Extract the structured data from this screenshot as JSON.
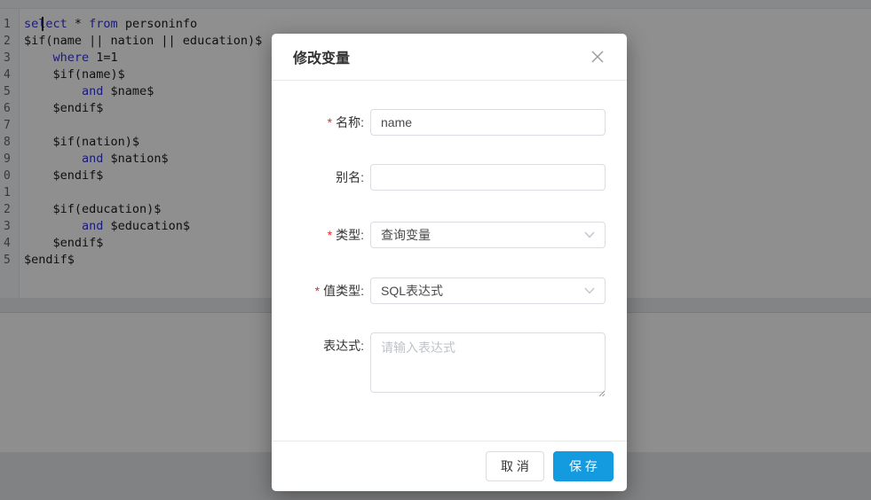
{
  "editor": {
    "gutter_digits": [
      "1",
      "2",
      "3",
      "4",
      "5",
      "6",
      "7",
      "8",
      "9",
      "0",
      "1",
      "2",
      "3",
      "4",
      "5"
    ],
    "lines": [
      [
        {
          "text": "select",
          "type": "keyword"
        },
        {
          "text": " * ",
          "type": "plain"
        },
        {
          "text": "from",
          "type": "keyword"
        },
        {
          "text": " personinfo",
          "type": "plain"
        }
      ],
      [
        {
          "text": "$if(name || nation || education)$",
          "type": "plain"
        }
      ],
      [
        {
          "text": "    ",
          "type": "plain"
        },
        {
          "text": "where",
          "type": "keyword"
        },
        {
          "text": " 1=1",
          "type": "plain"
        }
      ],
      [
        {
          "text": "    $if(name)$",
          "type": "plain"
        }
      ],
      [
        {
          "text": "        ",
          "type": "plain"
        },
        {
          "text": "and",
          "type": "keyword"
        },
        {
          "text": " $name$",
          "type": "plain"
        }
      ],
      [
        {
          "text": "    $endif$",
          "type": "plain"
        }
      ],
      [],
      [
        {
          "text": "    $if(nation)$",
          "type": "plain"
        }
      ],
      [
        {
          "text": "        ",
          "type": "plain"
        },
        {
          "text": "and",
          "type": "keyword"
        },
        {
          "text": " $nation$",
          "type": "plain"
        }
      ],
      [
        {
          "text": "    $endif$",
          "type": "plain"
        }
      ],
      [],
      [
        {
          "text": "    $if(education)$",
          "type": "plain"
        }
      ],
      [
        {
          "text": "        ",
          "type": "plain"
        },
        {
          "text": "and",
          "type": "keyword"
        },
        {
          "text": " $education$",
          "type": "plain"
        }
      ],
      [
        {
          "text": "    $endif$",
          "type": "plain"
        }
      ],
      [
        {
          "text": "$endif$",
          "type": "plain"
        }
      ]
    ],
    "colors": {
      "keyword": "#3032d8",
      "plain": "#1b1b1b"
    }
  },
  "modal": {
    "title": "修改变量",
    "required_mark": "*",
    "fields": [
      {
        "label": "名称:",
        "required": true,
        "type": "input",
        "value": "name",
        "placeholder": ""
      },
      {
        "label": "别名:",
        "required": false,
        "type": "input",
        "value": "",
        "placeholder": ""
      },
      {
        "label": "类型:",
        "required": true,
        "type": "select",
        "value": "查询变量"
      },
      {
        "label": "值类型:",
        "required": true,
        "type": "select",
        "value": "SQL表达式"
      },
      {
        "label": "表达式:",
        "required": false,
        "type": "textarea",
        "value": "",
        "placeholder": "请输入表达式"
      }
    ],
    "footer": {
      "cancel_label": "取 消",
      "save_label": "保 存"
    },
    "accent_color": "#149ade"
  }
}
